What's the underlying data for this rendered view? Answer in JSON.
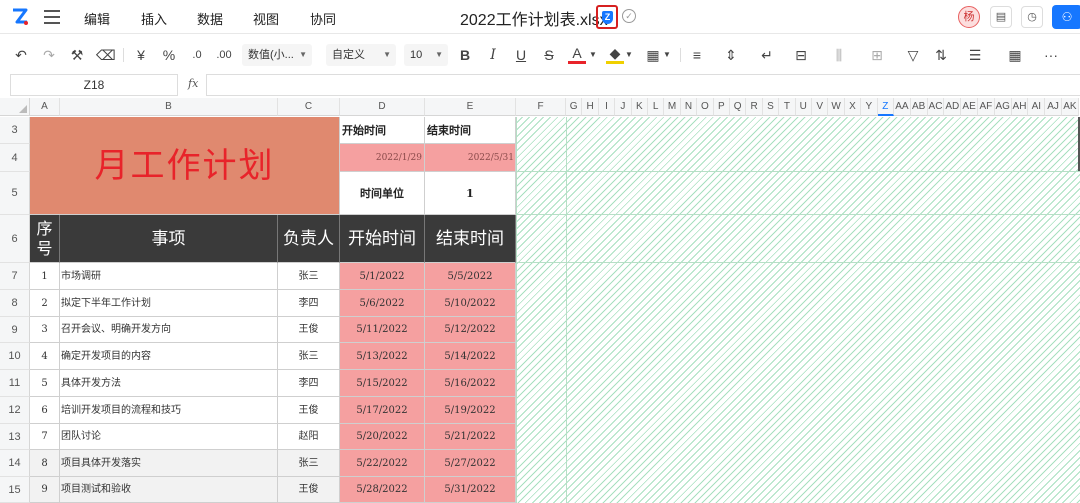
{
  "app": {
    "menus": [
      "编辑",
      "插入",
      "数据",
      "视图",
      "协同"
    ],
    "title": "2022工作计划表.xlsx",
    "avatar": "杨"
  },
  "toolbar": {
    "currency": "¥",
    "percent": "%",
    "number_format": "数值(小...",
    "custom_format": "自定义",
    "font_size": "10",
    "bold": "B",
    "italic": "I",
    "underline": "U",
    "strike": "S",
    "font_color": "A"
  },
  "formula_bar": {
    "cell_ref": "Z18",
    "fx_label": "fx",
    "value": ""
  },
  "columns": [
    "A",
    "B",
    "C",
    "D",
    "E",
    "F",
    "G",
    "H",
    "I",
    "J",
    "K",
    "L",
    "M",
    "N",
    "O",
    "P",
    "Q",
    "R",
    "S",
    "T",
    "U",
    "V",
    "W",
    "X",
    "Y",
    "Z",
    "AA",
    "AB",
    "AC",
    "AD",
    "AE",
    "AF",
    "AG",
    "AH",
    "AI",
    "AJ",
    "AK"
  ],
  "rows": [
    "3",
    "4",
    "5",
    "6",
    "7",
    "8",
    "9",
    "10",
    "11",
    "12",
    "13",
    "14",
    "15"
  ],
  "sheet": {
    "title": "月工作计划",
    "start_label": "开始时间",
    "end_label": "结束时间",
    "start_value": "2022/1/29",
    "end_value": "2022/5/31",
    "unit_label": "时间单位",
    "unit_value": "1",
    "headers": {
      "seq": "序号",
      "item": "事项",
      "owner": "负责人",
      "start": "开始时间",
      "end": "结束时间"
    },
    "tasks": [
      {
        "seq": "1",
        "item": "市场调研",
        "owner": "张三",
        "start": "5/1/2022",
        "end": "5/5/2022"
      },
      {
        "seq": "2",
        "item": "拟定下半年工作计划",
        "owner": "李四",
        "start": "5/6/2022",
        "end": "5/10/2022"
      },
      {
        "seq": "3",
        "item": "召开会议、明确开发方向",
        "owner": "王俊",
        "start": "5/11/2022",
        "end": "5/12/2022"
      },
      {
        "seq": "4",
        "item": "确定开发项目的内容",
        "owner": "张三",
        "start": "5/13/2022",
        "end": "5/14/2022"
      },
      {
        "seq": "5",
        "item": "具体开发方法",
        "owner": "李四",
        "start": "5/15/2022",
        "end": "5/16/2022"
      },
      {
        "seq": "6",
        "item": "培训开发项目的流程和技巧",
        "owner": "王俊",
        "start": "5/17/2022",
        "end": "5/19/2022"
      },
      {
        "seq": "7",
        "item": "团队讨论",
        "owner": "赵阳",
        "start": "5/20/2022",
        "end": "5/21/2022"
      },
      {
        "seq": "8",
        "item": "项目具体开发落实",
        "owner": "张三",
        "start": "5/22/2022",
        "end": "5/27/2022"
      },
      {
        "seq": "9",
        "item": "项目测试和验收",
        "owner": "王俊",
        "start": "5/28/2022",
        "end": "5/31/2022"
      }
    ]
  },
  "colors": {
    "title_bg": "#e0896f",
    "title_text": "#e8232a",
    "header_bg": "#3a3a3a",
    "date_bg": "#f5a0a0",
    "accent": "#1677ff",
    "hatch": "#a8e0c0"
  }
}
